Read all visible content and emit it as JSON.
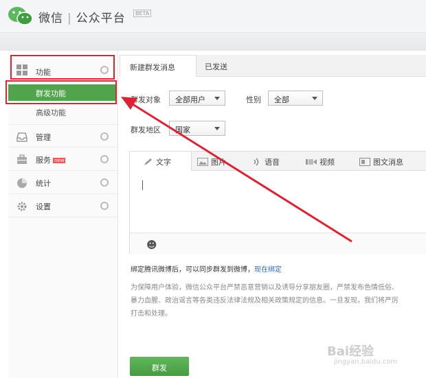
{
  "header": {
    "brand_wechat": "微信",
    "brand_separator": "|",
    "brand_platform": "公众平台",
    "beta_badge": "BETA"
  },
  "sidebar": {
    "items": [
      {
        "label": "功能",
        "icon": "grid-icon"
      },
      {
        "label": "管理",
        "icon": "inbox-icon"
      },
      {
        "label": "服务",
        "icon": "briefcase-icon",
        "badge": "new"
      },
      {
        "label": "统计",
        "icon": "pie-chart-icon"
      },
      {
        "label": "设置",
        "icon": "gear-icon"
      }
    ],
    "sub_items": [
      {
        "label": "群发功能",
        "active": true
      },
      {
        "label": "高级功能",
        "active": false
      }
    ]
  },
  "tabs": [
    {
      "label": "新建群发消息",
      "active": true
    },
    {
      "label": "已发送",
      "active": false
    }
  ],
  "form": {
    "target_label": "群发对象",
    "target_value": "全部用户",
    "gender_label": "性别",
    "gender_value": "全部",
    "region_label": "群发地区",
    "region_value": "国家"
  },
  "editor": {
    "tabs": [
      {
        "label": "文字",
        "active": true
      },
      {
        "label": "图片"
      },
      {
        "label": "语音"
      },
      {
        "label": "视频"
      },
      {
        "label": "图文消息"
      }
    ],
    "emoji_icon": "☻"
  },
  "bind_notice": {
    "text": "绑定腾讯微博后，可以同步群发到微博，",
    "link": "现在绑定"
  },
  "policy_notice": "为保障用户体验，微信公众平台严禁恶意营销以及诱导分享朋友圈，严禁发布色情低俗、暴力血腥、政治谣言等各类违反法律法规及相关政策规定的信息。一旦发现，我们将严厉打击和处理。",
  "send_button": "群发",
  "watermark": {
    "text": "Bai经验",
    "url": "jingyan.baidu.com"
  },
  "colors": {
    "accent_green": "#51a44b",
    "annotation_red": "#d23",
    "link_blue": "#2d6bb5"
  }
}
